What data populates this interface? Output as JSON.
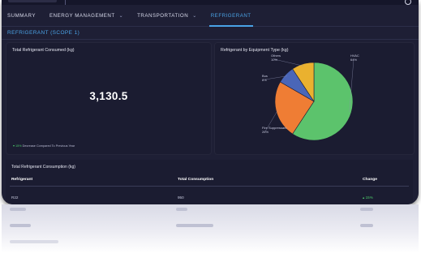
{
  "nav": {
    "items": [
      {
        "label": "SUMMARY",
        "dropdown": false,
        "active": false
      },
      {
        "label": "ENERGY MANAGEMENT",
        "dropdown": true,
        "active": false
      },
      {
        "label": "TRANSPORTATION",
        "dropdown": true,
        "active": false
      },
      {
        "label": "REFRIGERANT",
        "dropdown": false,
        "active": true
      }
    ]
  },
  "section_title": "REFRIGERANT (SCOPE 1)",
  "total_card": {
    "title": "Total Refrigerant Consumed (kg)",
    "value": "3,130.5",
    "change_pct": "15%",
    "change_text": "Decrease Compared To Previous Year"
  },
  "pie_card": {
    "title": "Refrigerant by Equipment Type (kg)"
  },
  "chart_data": {
    "type": "pie",
    "title": "Refrigerant by Equipment Type (kg)",
    "slices": [
      {
        "label": "HVAC",
        "pct_label": "64%",
        "value": 64,
        "color": "#5cc36c"
      },
      {
        "label": "Fire Suppressant",
        "pct_label": "26%",
        "value": 26,
        "color": "#ef7d34"
      },
      {
        "label": "Bus",
        "pct_label": "8%",
        "value": 8,
        "color": "#4a66b8"
      },
      {
        "label": "Others",
        "pct_label": "10%",
        "value": 10,
        "color": "#eab12f"
      }
    ]
  },
  "table": {
    "title": "Total Refrigerant Consumption (kg)",
    "headers": [
      "Refrigerant",
      "Total Consumption",
      "Change"
    ],
    "rows": [
      [
        "R22",
        "950",
        "15%"
      ]
    ]
  },
  "colors": {
    "accent": "#4aa3e6",
    "positive": "#4cc96a",
    "background": "#1e1f35"
  }
}
